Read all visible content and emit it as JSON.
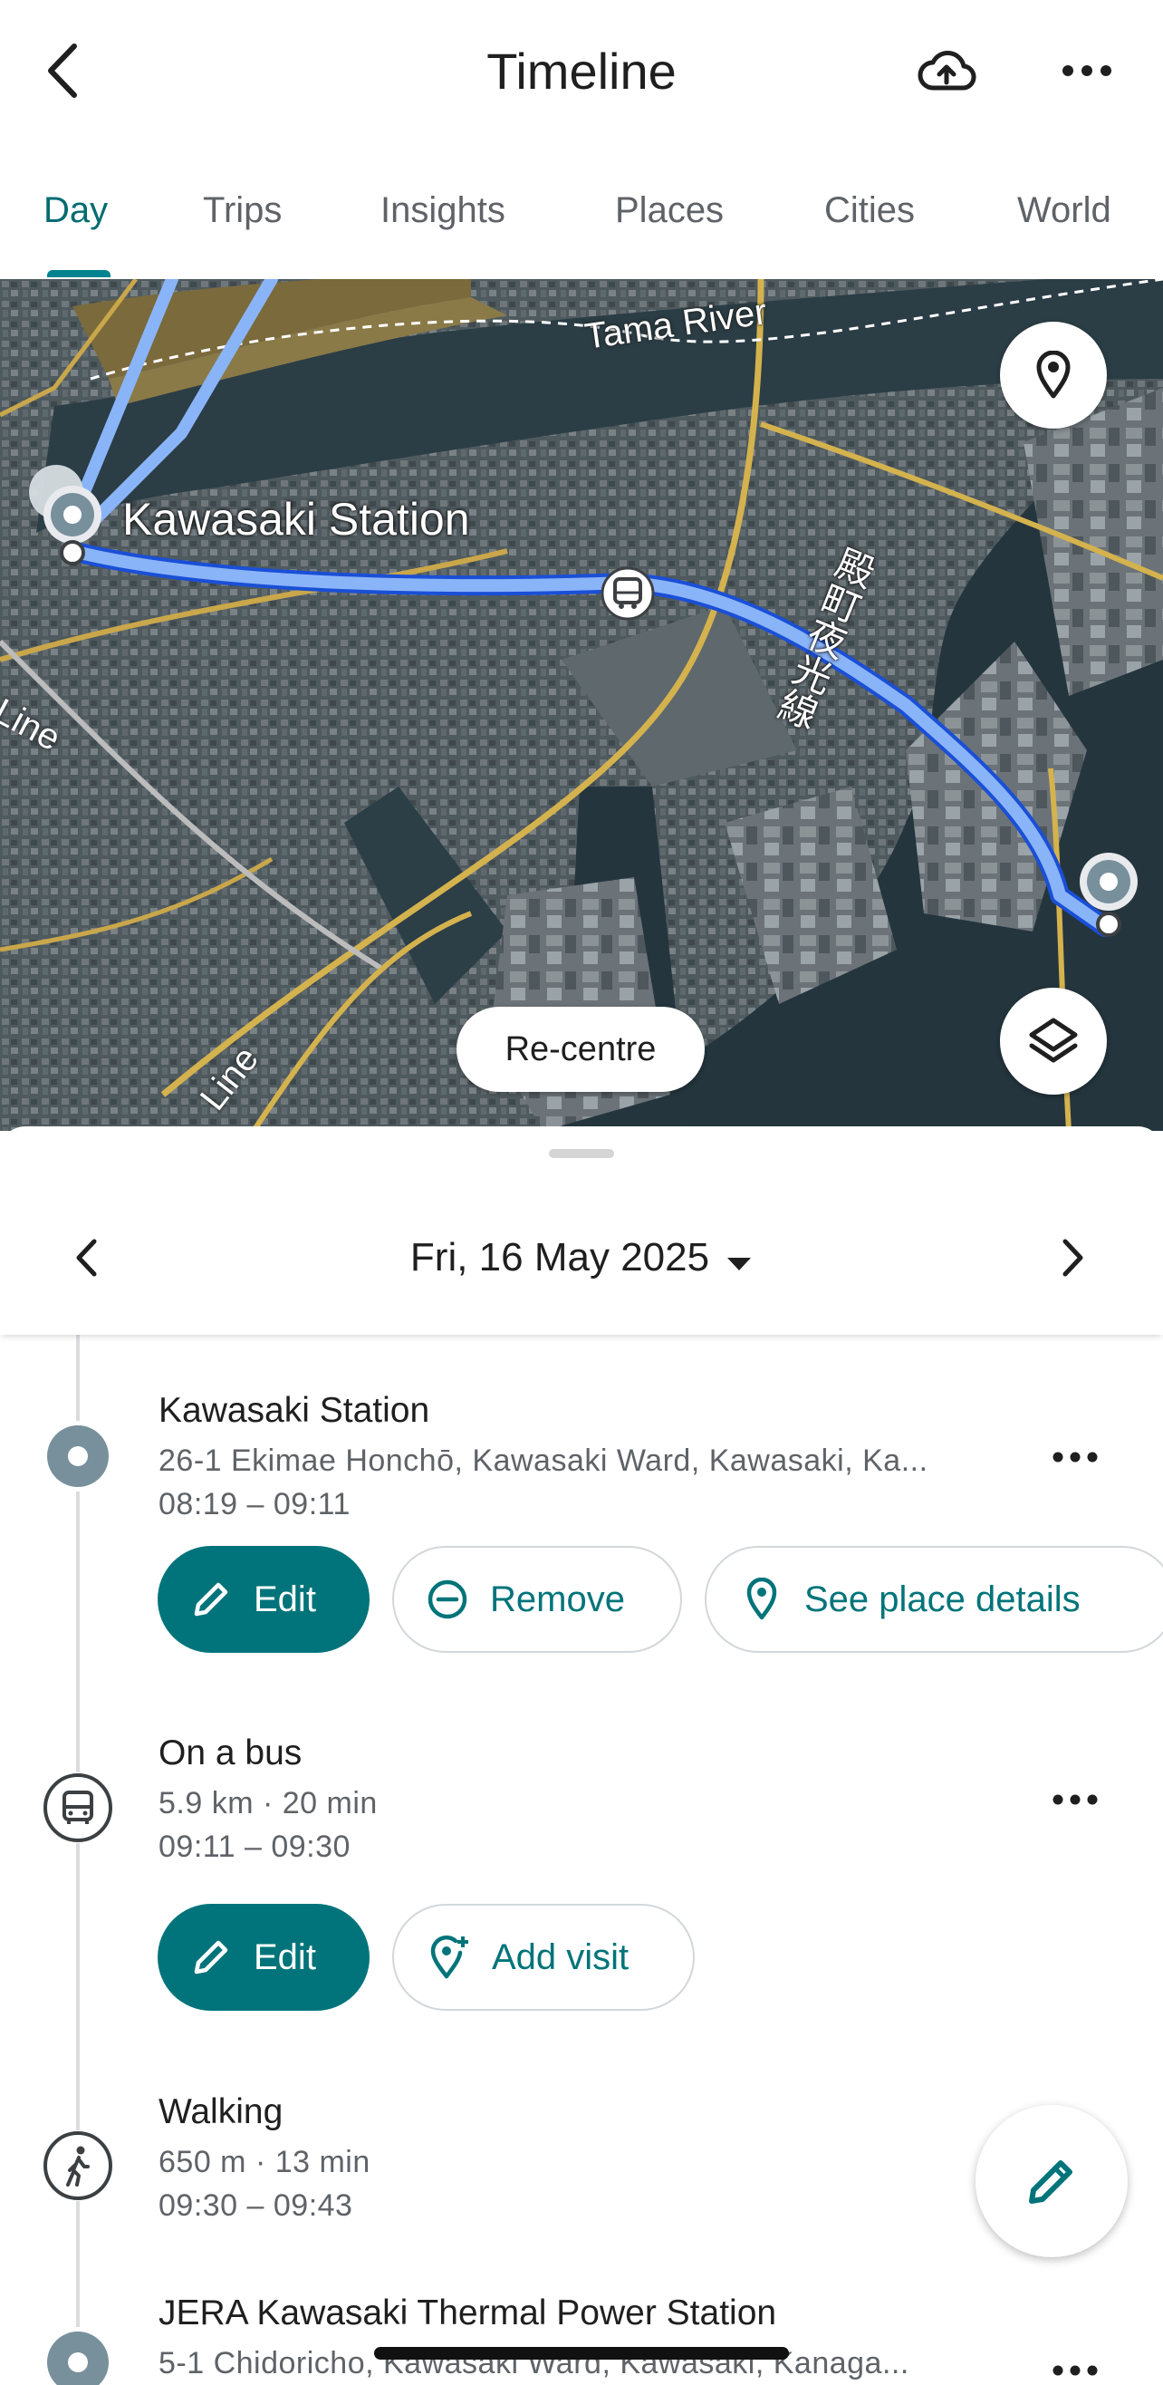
{
  "header": {
    "title": "Timeline"
  },
  "tabs": [
    {
      "label": "Day",
      "active": true
    },
    {
      "label": "Trips",
      "active": false
    },
    {
      "label": "Insights",
      "active": false
    },
    {
      "label": "Places",
      "active": false
    },
    {
      "label": "Cities",
      "active": false
    },
    {
      "label": "World",
      "active": false
    }
  ],
  "map": {
    "labels": {
      "river": "Tama River",
      "station": "Kawasaki Station",
      "rail_line_right": "殿町夜光線",
      "line_left": "Line",
      "line_bottom": "Line"
    },
    "recentre_label": "Re-centre"
  },
  "date_nav": {
    "date": "Fri, 16 May 2025"
  },
  "entries": [
    {
      "title": "Kawasaki Station",
      "address": "26-1 Ekimae Honchō, Kawasaki Ward, Kawasaki, Ka...",
      "time": "08:19 – 09:11",
      "actions": {
        "edit": "Edit",
        "remove": "Remove",
        "details": "See place details"
      }
    },
    {
      "title": "On a bus",
      "distance": "5.9 km · 20 min",
      "time": "09:11 – 09:30",
      "actions": {
        "edit": "Edit",
        "add_visit": "Add visit"
      }
    },
    {
      "title": "Walking",
      "distance": "650 m · 13 min",
      "time": "09:30 – 09:43"
    },
    {
      "title": "JERA Kawasaki Thermal Power Station",
      "address": "5-1 Chidoricho, Kawasaki Ward, Kawasaki, Kanaga..."
    }
  ],
  "colors": {
    "accent": "#00747a",
    "route": "#8ab4f8",
    "route_dark": "#1a4fd6"
  },
  "icons": {
    "back": "chevron-left-icon",
    "cloud": "cloud-upload-icon",
    "more": "more-horizontal-icon",
    "pin": "location-pin-icon",
    "layers": "layers-icon",
    "bus": "bus-icon",
    "walk": "walking-icon",
    "edit": "pencil-icon"
  }
}
